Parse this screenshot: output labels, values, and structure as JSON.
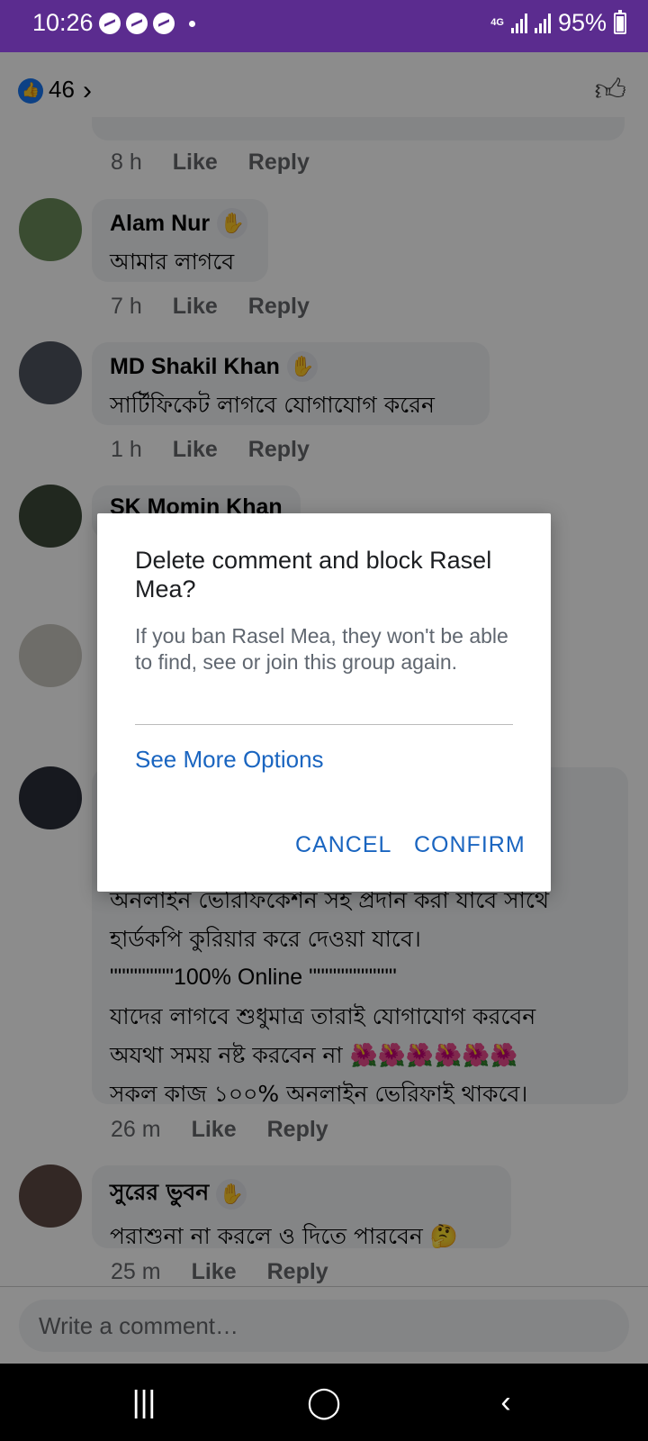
{
  "status_bar": {
    "time": "10:26",
    "network": "4G",
    "battery": "95%"
  },
  "top_bar": {
    "like_count": "46",
    "like_icon": "thumbs-up-icon"
  },
  "comments": [
    {
      "meta": {
        "time": "8 h",
        "like": "Like",
        "reply": "Reply"
      }
    },
    {
      "author": "Alam Nur",
      "text": "আমার লাগবে",
      "meta": {
        "time": "7 h",
        "like": "Like",
        "reply": "Reply"
      }
    },
    {
      "author": "MD Shakil Khan",
      "text": "সার্টিফিকেট লাগবে যোগাযোগ করেন",
      "meta": {
        "time": "1 h",
        "like": "Like",
        "reply": "Reply"
      }
    },
    {
      "author": "SK Momin Khan"
    },
    {
      "lines": [
        "অনলাইন ভেরিফিকেশন সহ প্রদান করা যাবে সাথে",
        "হার্ডকপি  কুরিয়ার করে দেওয়া যাবে।",
        "\"\"\"\"\"\"\"\"100% Online \"\"\"\"\"\"\"\"\"\"\"",
        "যাদের লাগবে শুধুমাত্র তারাই যোগাযোগ করবেন",
        "অযথা সময় নষ্ট করবেন না 🌺🌺🌺🌺🌺🌺",
        "সকল কাজ ১০০% অনলাইন ভেরিফাই থাকবে।"
      ],
      "meta": {
        "time": "26 m",
        "like": "Like",
        "reply": "Reply"
      }
    },
    {
      "author": "সুরের ভুবন",
      "text": "পরাশুনা না করলে ও দিতে পারবেন 🤔",
      "meta": {
        "time": "25 m",
        "like": "Like",
        "reply": "Reply"
      }
    }
  ],
  "composer": {
    "placeholder": "Write a comment…"
  },
  "dialog": {
    "title": "Delete comment and block Rasel Mea?",
    "body": "If you ban Rasel Mea, they won't be able to find, see or join this group again.",
    "more": "See More Options",
    "cancel": "CANCEL",
    "confirm": "CONFIRM"
  },
  "colors": {
    "status_bar": "#5b2c8f",
    "link_blue": "#1a65c0",
    "like_blue": "#1877f2"
  }
}
